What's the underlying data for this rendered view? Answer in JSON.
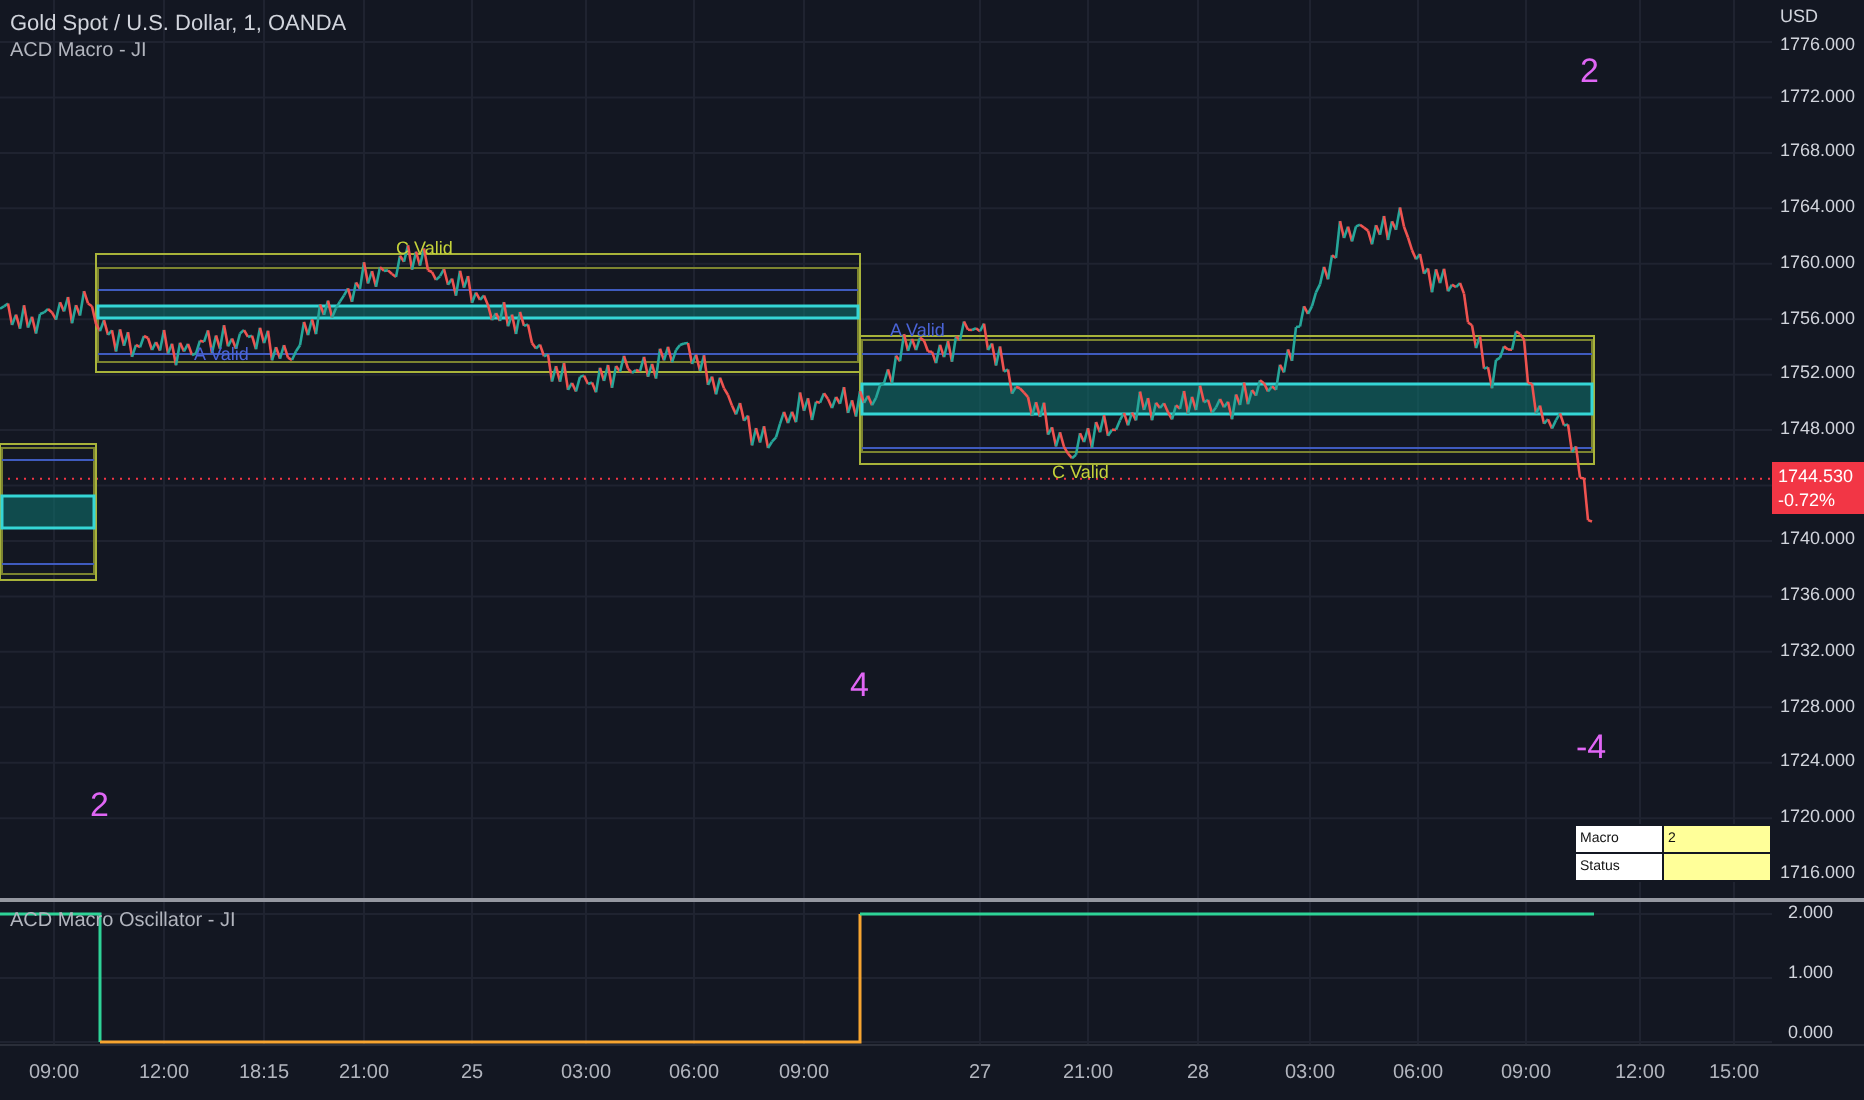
{
  "header": {
    "symbol": "Gold Spot / U.S. Dollar, 1, OANDA",
    "indicator": "ACD Macro - JI"
  },
  "price_axis": {
    "currency": "USD",
    "ticks": [
      "1776.000",
      "1772.000",
      "1768.000",
      "1764.000",
      "1760.000",
      "1756.000",
      "1752.000",
      "1748.000",
      "1740.000",
      "1736.000",
      "1732.000",
      "1728.000",
      "1724.000",
      "1720.000",
      "1716.000"
    ]
  },
  "last_price": {
    "price": "1744.530",
    "change": "-0.72%"
  },
  "chart_labels": [
    {
      "text": "C Valid",
      "kind": "c"
    },
    {
      "text": "A Valid",
      "kind": "a"
    },
    {
      "text": "A Valid",
      "kind": "a"
    },
    {
      "text": "C Valid",
      "kind": "c"
    }
  ],
  "macro_numbers": [
    "2",
    "4",
    "2",
    "-4"
  ],
  "macro_table": {
    "rows": [
      {
        "label": "Macro",
        "value": "2"
      },
      {
        "label": "Status"
      }
    ]
  },
  "oscillator": {
    "title": "ACD Macro Oscillator - JI",
    "ticks": [
      "2.000",
      "1.000",
      "0.000"
    ]
  },
  "time_axis": {
    "ticks": [
      "09:00",
      "12:00",
      "18:15",
      "21:00",
      "25",
      "03:00",
      "06:00",
      "09:00",
      "27",
      "21:00",
      "28",
      "03:00",
      "06:00",
      "09:00",
      "12:00",
      "15:00"
    ]
  }
}
